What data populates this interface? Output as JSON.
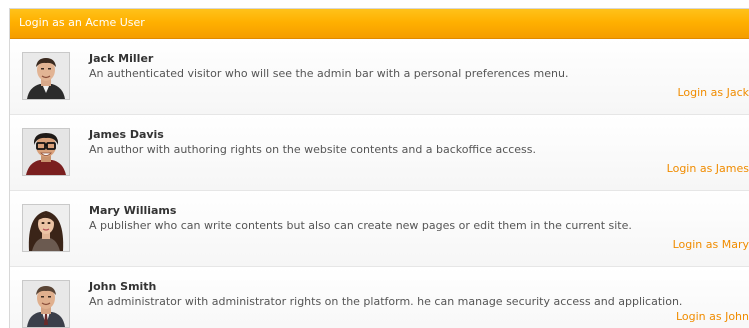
{
  "panel": {
    "title": "Login as an Acme User"
  },
  "users": [
    {
      "name": "Jack Miller",
      "description": "An authenticated visitor who will see the admin bar with a personal preferences menu.",
      "login_label": "Login as Jack",
      "avatar_icon": "user-avatar-photo"
    },
    {
      "name": "James Davis",
      "description": "An author with authoring rights on the website contents and a backoffice access.",
      "login_label": "Login as James",
      "avatar_icon": "user-avatar-photo"
    },
    {
      "name": "Mary Williams",
      "description": "A publisher who can write contents but also can create new pages or edit them in the current site.",
      "login_label": "Login as Mary",
      "avatar_icon": "user-avatar-photo"
    },
    {
      "name": "John Smith",
      "description": "An administrator with administrator rights on the platform. he can manage security access and application.",
      "login_label": "Login as John",
      "avatar_icon": "user-avatar-photo"
    }
  ],
  "colors": {
    "header_top": "#ffc21a",
    "header_bottom": "#f59d00",
    "link": "#f08c00",
    "name_text": "#333333",
    "desc_text": "#555555"
  }
}
